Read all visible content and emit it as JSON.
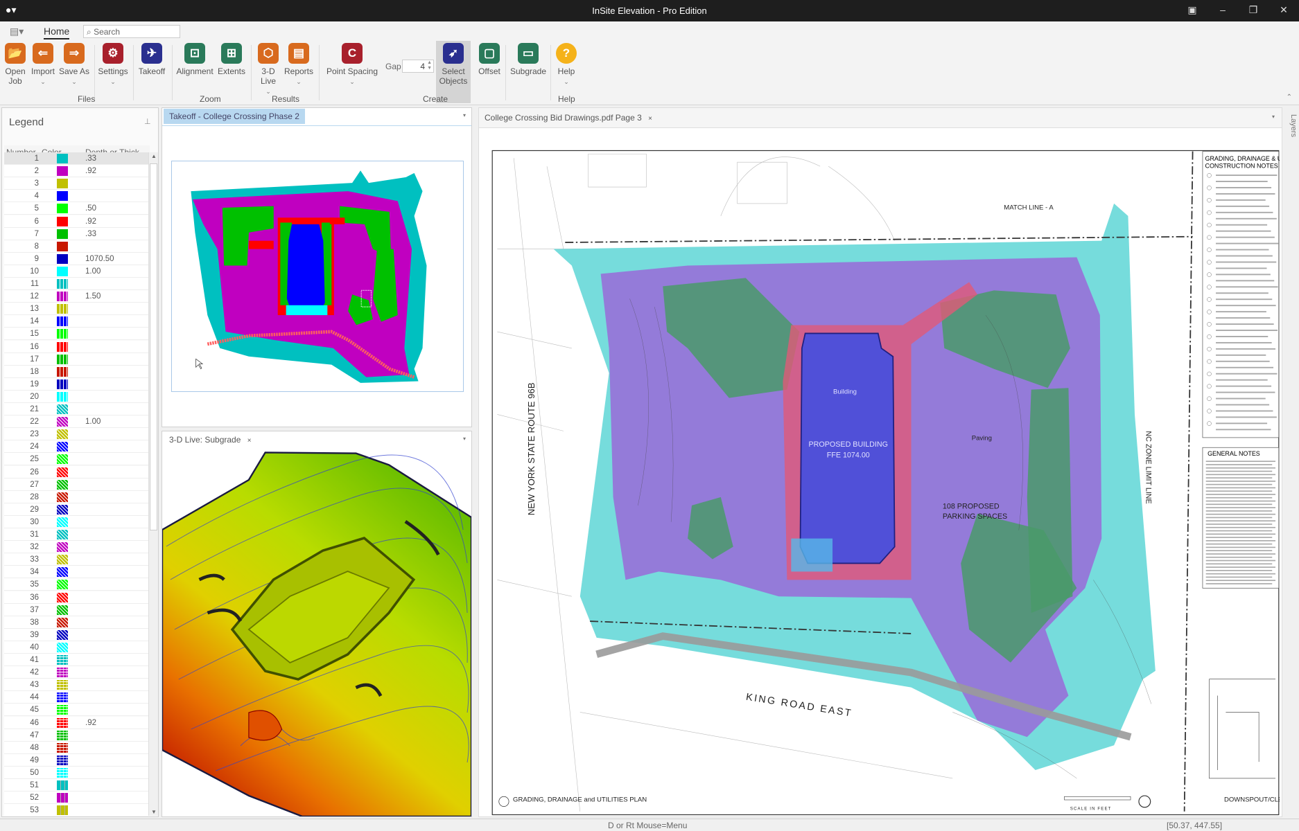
{
  "app": {
    "title": "InSite Elevation - Pro Edition"
  },
  "ribbon": {
    "tab": "Home",
    "search_placeholder": "Search",
    "buttons": {
      "open_job": [
        "Open",
        "Job"
      ],
      "import": "Import",
      "save_as": "Save As",
      "settings": "Settings",
      "takeoff": "Takeoff",
      "alignment": "Alignment",
      "extents": "Extents",
      "live3d": [
        "3-D",
        "Live"
      ],
      "reports": "Reports",
      "point_spacing": "Point Spacing",
      "gap_label": "Gap",
      "gap_value": "4",
      "select_objects": [
        "Select",
        "Objects"
      ],
      "offset": "Offset",
      "subgrade": "Subgrade",
      "help": "Help"
    },
    "groups": {
      "files": "Files",
      "zoom": "Zoom",
      "results": "Results",
      "create": "Create",
      "help": "Help"
    },
    "colors": {
      "orange": "#d86a1e",
      "red": "#a8202c",
      "navy": "#2a2f8f",
      "green": "#2a7a5a",
      "yellow": "#f5b21a"
    }
  },
  "legend": {
    "title": "Legend",
    "columns": [
      "Number",
      "Color",
      "Depth or Thick..."
    ],
    "rows": [
      {
        "n": "1",
        "c": "#00c0c0",
        "p": "solid",
        "d": ".33"
      },
      {
        "n": "2",
        "c": "#c000c0",
        "p": "solid",
        "d": ".92"
      },
      {
        "n": "3",
        "c": "#c0c000",
        "p": "solid",
        "d": ""
      },
      {
        "n": "4",
        "c": "#0000ff",
        "p": "solid",
        "d": ""
      },
      {
        "n": "5",
        "c": "#00ff00",
        "p": "solid",
        "d": ".50"
      },
      {
        "n": "6",
        "c": "#ff0000",
        "p": "solid",
        "d": ".92"
      },
      {
        "n": "7",
        "c": "#00c000",
        "p": "solid",
        "d": ".33"
      },
      {
        "n": "8",
        "c": "#c81800",
        "p": "solid",
        "d": ""
      },
      {
        "n": "9",
        "c": "#0000c0",
        "p": "solid",
        "d": "1070.50"
      },
      {
        "n": "10",
        "c": "#00ffff",
        "p": "solid",
        "d": "1.00"
      },
      {
        "n": "11",
        "c": "#00c0c0",
        "p": "vstripe",
        "d": ""
      },
      {
        "n": "12",
        "c": "#c000c0",
        "p": "vstripe",
        "d": "1.50"
      },
      {
        "n": "13",
        "c": "#c0c000",
        "p": "vstripe",
        "d": ""
      },
      {
        "n": "14",
        "c": "#0000ff",
        "p": "vstripe",
        "d": ""
      },
      {
        "n": "15",
        "c": "#00ff00",
        "p": "vstripe",
        "d": ""
      },
      {
        "n": "16",
        "c": "#ff0000",
        "p": "vstripe",
        "d": ""
      },
      {
        "n": "17",
        "c": "#00c000",
        "p": "vstripe",
        "d": ""
      },
      {
        "n": "18",
        "c": "#c81800",
        "p": "vstripe",
        "d": ""
      },
      {
        "n": "19",
        "c": "#0000c0",
        "p": "vstripe",
        "d": ""
      },
      {
        "n": "20",
        "c": "#00ffff",
        "p": "vstripe",
        "d": ""
      },
      {
        "n": "21",
        "c": "#00c0c0",
        "p": "diag",
        "d": ""
      },
      {
        "n": "22",
        "c": "#c000c0",
        "p": "diag",
        "d": "1.00"
      },
      {
        "n": "23",
        "c": "#c0c000",
        "p": "diag",
        "d": ""
      },
      {
        "n": "24",
        "c": "#0000ff",
        "p": "diag",
        "d": ""
      },
      {
        "n": "25",
        "c": "#00ff00",
        "p": "diag",
        "d": ""
      },
      {
        "n": "26",
        "c": "#ff0000",
        "p": "diag",
        "d": ""
      },
      {
        "n": "27",
        "c": "#00c000",
        "p": "diag",
        "d": ""
      },
      {
        "n": "28",
        "c": "#c81800",
        "p": "diag",
        "d": ""
      },
      {
        "n": "29",
        "c": "#0000c0",
        "p": "diag",
        "d": ""
      },
      {
        "n": "30",
        "c": "#00ffff",
        "p": "diag",
        "d": ""
      },
      {
        "n": "31",
        "c": "#00c0c0",
        "p": "diag",
        "d": ""
      },
      {
        "n": "32",
        "c": "#c000c0",
        "p": "diag",
        "d": ""
      },
      {
        "n": "33",
        "c": "#c0c000",
        "p": "diag",
        "d": ""
      },
      {
        "n": "34",
        "c": "#0000ff",
        "p": "diag",
        "d": ""
      },
      {
        "n": "35",
        "c": "#00ff00",
        "p": "diag",
        "d": ""
      },
      {
        "n": "36",
        "c": "#ff0000",
        "p": "diag",
        "d": ""
      },
      {
        "n": "37",
        "c": "#00c000",
        "p": "diag",
        "d": ""
      },
      {
        "n": "38",
        "c": "#c81800",
        "p": "diag",
        "d": ""
      },
      {
        "n": "39",
        "c": "#0000c0",
        "p": "diag",
        "d": ""
      },
      {
        "n": "40",
        "c": "#00ffff",
        "p": "diag",
        "d": ""
      },
      {
        "n": "41",
        "c": "#00c0c0",
        "p": "grid",
        "d": ""
      },
      {
        "n": "42",
        "c": "#c000c0",
        "p": "grid",
        "d": ""
      },
      {
        "n": "43",
        "c": "#c0c000",
        "p": "grid",
        "d": ""
      },
      {
        "n": "44",
        "c": "#0000ff",
        "p": "grid",
        "d": ""
      },
      {
        "n": "45",
        "c": "#00ff00",
        "p": "grid",
        "d": ""
      },
      {
        "n": "46",
        "c": "#ff0000",
        "p": "grid",
        "d": ".92"
      },
      {
        "n": "47",
        "c": "#00c000",
        "p": "grid",
        "d": ""
      },
      {
        "n": "48",
        "c": "#c81800",
        "p": "grid",
        "d": ""
      },
      {
        "n": "49",
        "c": "#0000c0",
        "p": "grid",
        "d": ""
      },
      {
        "n": "50",
        "c": "#00ffff",
        "p": "grid",
        "d": ""
      },
      {
        "n": "51",
        "c": "#00c0c0",
        "p": "thick",
        "d": ""
      },
      {
        "n": "52",
        "c": "#c000c0",
        "p": "thick",
        "d": ""
      },
      {
        "n": "53",
        "c": "#c0c000",
        "p": "thick",
        "d": ""
      }
    ]
  },
  "panes": {
    "takeoff_tab": "Takeoff - College Crossing Phase 2",
    "live_tab": "3-D Live: Subgrade",
    "pdf_tab": "College Crossing Bid Drawings.pdf Page 3",
    "close": "×",
    "layers": "Layers"
  },
  "drawing": {
    "route": "NEW YORK STATE ROUTE 96B",
    "road": "KING ROAD EAST",
    "building1": "PROPOSED BUILDING",
    "building2": "FFE 1074.00",
    "building_label": "Building",
    "parking1": "108 PROPOSED",
    "parking2": "PARKING SPACES",
    "paving": "Paving",
    "match_line": "MATCH LINE - A",
    "zone_line": "NC ZONE LIMIT LINE",
    "plan_title": "GRADING, DRAINAGE and UTILITIES PLAN",
    "scale": "SCALE IN FEET",
    "notes_title1": "GRADING, DRAINAGE & UTI",
    "notes_title2": "CONSTRUCTION NOTES",
    "general_notes": "GENERAL NOTES",
    "detail": "DOWNSPOUT/CLEA"
  },
  "status": {
    "hint": "D or Rt Mouse=Menu",
    "coords": "[50.37, 447.55]"
  }
}
